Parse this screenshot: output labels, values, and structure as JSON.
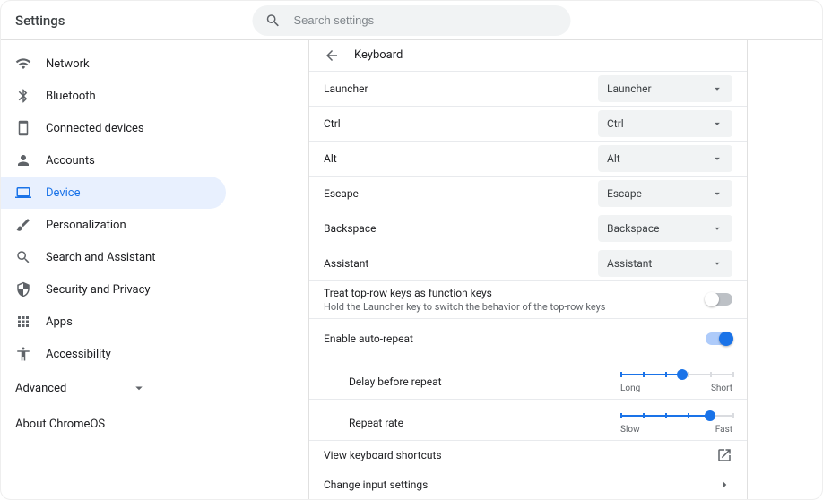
{
  "header": {
    "title": "Settings",
    "search_placeholder": "Search settings"
  },
  "sidebar": {
    "items": [
      {
        "label": "Network",
        "icon": "wifi"
      },
      {
        "label": "Bluetooth",
        "icon": "bluetooth"
      },
      {
        "label": "Connected devices",
        "icon": "device"
      },
      {
        "label": "Accounts",
        "icon": "person"
      },
      {
        "label": "Device",
        "icon": "laptop",
        "active": true
      },
      {
        "label": "Personalization",
        "icon": "brush"
      },
      {
        "label": "Search and Assistant",
        "icon": "search"
      },
      {
        "label": "Security and Privacy",
        "icon": "shield"
      },
      {
        "label": "Apps",
        "icon": "apps"
      },
      {
        "label": "Accessibility",
        "icon": "accessibility"
      }
    ],
    "advanced_label": "Advanced",
    "about_label": "About ChromeOS"
  },
  "page": {
    "title": "Keyboard",
    "key_rows": [
      {
        "label": "Launcher",
        "value": "Launcher"
      },
      {
        "label": "Ctrl",
        "value": "Ctrl"
      },
      {
        "label": "Alt",
        "value": "Alt"
      },
      {
        "label": "Escape",
        "value": "Escape"
      },
      {
        "label": "Backspace",
        "value": "Backspace"
      },
      {
        "label": "Assistant",
        "value": "Assistant"
      }
    ],
    "top_row": {
      "label": "Treat top-row keys as function keys",
      "sublabel": "Hold the Launcher key to switch the behavior of the top-row keys",
      "on": false
    },
    "auto_repeat": {
      "label": "Enable auto-repeat",
      "on": true,
      "delay": {
        "label": "Delay before repeat",
        "min_label": "Long",
        "max_label": "Short",
        "value": 55
      },
      "rate": {
        "label": "Repeat rate",
        "min_label": "Slow",
        "max_label": "Fast",
        "value": 80
      }
    },
    "shortcuts_label": "View keyboard shortcuts",
    "input_label": "Change input settings"
  }
}
